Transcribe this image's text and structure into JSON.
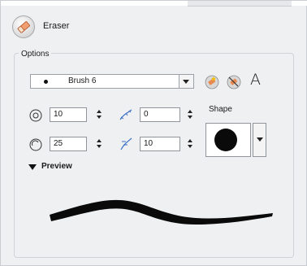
{
  "tool": {
    "name": "Eraser",
    "icon": "eraser-icon"
  },
  "options": {
    "section_label": "Options",
    "brush_preset": "Brush 6",
    "icons": [
      "new-brush-icon",
      "delete-brush-icon",
      "text-a-icon"
    ],
    "text_icon_glyph": "A"
  },
  "size": {
    "min_size": "10",
    "max_size": "25",
    "smoothing": "0",
    "contour_smoothing": "10"
  },
  "shape": {
    "label": "Shape",
    "selected": "round-tip"
  },
  "preview": {
    "label": "Preview",
    "expanded": true
  },
  "colors": {
    "panel": "#eef0f2",
    "stroke": "#0a0a0a",
    "border": "#8f959b"
  }
}
